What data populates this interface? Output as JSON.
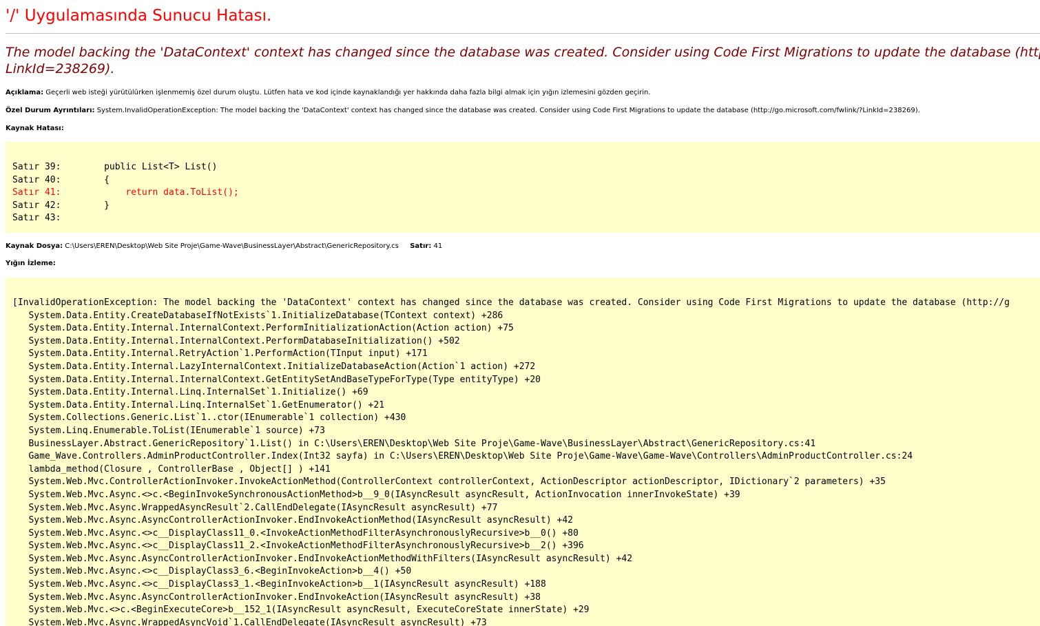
{
  "page_title": "'/' Uygulamasında Sunucu Hatası.",
  "error_message": {
    "line1": "The model backing the 'DataContext' context has changed since the database was created. Consider using Code First Migrations to update the database (http://",
    "line2": "LinkId=238269)."
  },
  "description": {
    "label": "Açıklama:",
    "text": "Geçerli web isteği yürütülürken işlenmemiş özel durum oluştu. Lütfen hata ve kod içinde kaynaklandığı yer hakkında daha fazla bilgi almak için yığın izlemesini gözden geçirin."
  },
  "exception_details": {
    "label": "Özel Durum Ayrıntıları:",
    "text": "System.InvalidOperationException: The model backing the 'DataContext' context has changed since the database was created. Consider using Code First Migrations to update the database (http://go.microsoft.com/fwlink/?LinkId=238269)."
  },
  "source_error": {
    "label": "Kaynak Hatası:",
    "lines": [
      {
        "prefix": "Satır 39:",
        "code": "        public List<T> List()",
        "highlight": false
      },
      {
        "prefix": "Satır 40:",
        "code": "        {",
        "highlight": false
      },
      {
        "prefix": "Satır 41:",
        "code": "            return data.ToList();",
        "highlight": true
      },
      {
        "prefix": "Satır 42:",
        "code": "        }",
        "highlight": false
      },
      {
        "prefix": "Satır 43:",
        "code": "",
        "highlight": false
      }
    ]
  },
  "source_file": {
    "label": "Kaynak Dosya:",
    "path": "C:\\Users\\EREN\\Desktop\\Web Site Proje\\Game-Wave\\BusinessLayer\\Abstract\\GenericRepository.cs",
    "line_label": "Satır:",
    "line_value": "41"
  },
  "stack_trace": {
    "label": "Yığın İzleme:",
    "lines": [
      "[InvalidOperationException: The model backing the 'DataContext' context has changed since the database was created. Consider using Code First Migrations to update the database (http://g",
      "   System.Data.Entity.CreateDatabaseIfNotExists`1.InitializeDatabase(TContext context) +286",
      "   System.Data.Entity.Internal.InternalContext.PerformInitializationAction(Action action) +75",
      "   System.Data.Entity.Internal.InternalContext.PerformDatabaseInitialization() +502",
      "   System.Data.Entity.Internal.RetryAction`1.PerformAction(TInput input) +171",
      "   System.Data.Entity.Internal.LazyInternalContext.InitializeDatabaseAction(Action`1 action) +272",
      "   System.Data.Entity.Internal.InternalContext.GetEntitySetAndBaseTypeForType(Type entityType) +20",
      "   System.Data.Entity.Internal.Linq.InternalSet`1.Initialize() +69",
      "   System.Data.Entity.Internal.Linq.InternalSet`1.GetEnumerator() +21",
      "   System.Collections.Generic.List`1..ctor(IEnumerable`1 collection) +430",
      "   System.Linq.Enumerable.ToList(IEnumerable`1 source) +73",
      "   BusinessLayer.Abstract.GenericRepository`1.List() in C:\\Users\\EREN\\Desktop\\Web Site Proje\\Game-Wave\\BusinessLayer\\Abstract\\GenericRepository.cs:41",
      "   Game_Wave.Controllers.AdminProductController.Index(Int32 sayfa) in C:\\Users\\EREN\\Desktop\\Web Site Proje\\Game-Wave\\Game-Wave\\Controllers\\AdminProductController.cs:24",
      "   lambda_method(Closure , ControllerBase , Object[] ) +141",
      "   System.Web.Mvc.ControllerActionInvoker.InvokeActionMethod(ControllerContext controllerContext, ActionDescriptor actionDescriptor, IDictionary`2 parameters) +35",
      "   System.Web.Mvc.Async.<>c.<BeginInvokeSynchronousActionMethod>b__9_0(IAsyncResult asyncResult, ActionInvocation innerInvokeState) +39",
      "   System.Web.Mvc.Async.WrappedAsyncResult`2.CallEndDelegate(IAsyncResult asyncResult) +77",
      "   System.Web.Mvc.Async.AsyncControllerActionInvoker.EndInvokeActionMethod(IAsyncResult asyncResult) +42",
      "   System.Web.Mvc.Async.<>c__DisplayClass11_0.<InvokeActionMethodFilterAsynchronouslyRecursive>b__0() +80",
      "   System.Web.Mvc.Async.<>c__DisplayClass11_2.<InvokeActionMethodFilterAsynchronouslyRecursive>b__2() +396",
      "   System.Web.Mvc.Async.AsyncControllerActionInvoker.EndInvokeActionMethodWithFilters(IAsyncResult asyncResult) +42",
      "   System.Web.Mvc.Async.<>c__DisplayClass3_6.<BeginInvokeAction>b__4() +50",
      "   System.Web.Mvc.Async.<>c__DisplayClass3_1.<BeginInvokeAction>b__1(IAsyncResult asyncResult) +188",
      "   System.Web.Mvc.Async.AsyncControllerActionInvoker.EndInvokeAction(IAsyncResult asyncResult) +38",
      "   System.Web.Mvc.<>c.<BeginExecuteCore>b__152_1(IAsyncResult asyncResult, ExecuteCoreState innerState) +29",
      "   System.Web.Mvc.Async.WrappedAsyncVoid`1.CallEndDelegate(IAsyncResult asyncResult) +73"
    ]
  },
  "colors": {
    "title": "#ff0000",
    "message": "#800000",
    "code_background": "#ffffcc",
    "highlight_line": "#ff0000"
  }
}
